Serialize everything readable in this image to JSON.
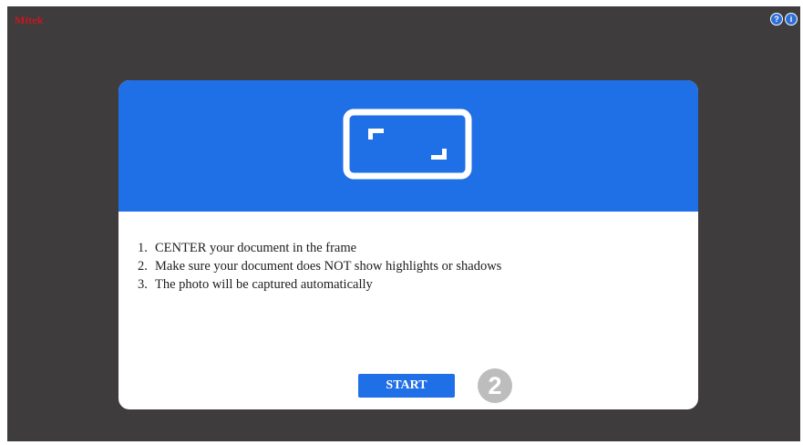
{
  "app": {
    "brand": "Mitek"
  },
  "top_bar": {
    "help_icon_glyph": "?",
    "info_icon_glyph": "i"
  },
  "modal": {
    "icon": "document-frame-icon",
    "instructions": [
      {
        "num": "1.",
        "text": "CENTER your document in the frame"
      },
      {
        "num": "2.",
        "text": "Make sure your document does NOT show highlights or shadows"
      },
      {
        "num": "3.",
        "text": "The photo will be captured automatically"
      }
    ],
    "start_label": "START",
    "step_number": "2"
  },
  "colors": {
    "background": "#3f3c3d",
    "accent": "#1f6fe6",
    "brand": "#c8171e",
    "badge": "#bdbdbd"
  }
}
